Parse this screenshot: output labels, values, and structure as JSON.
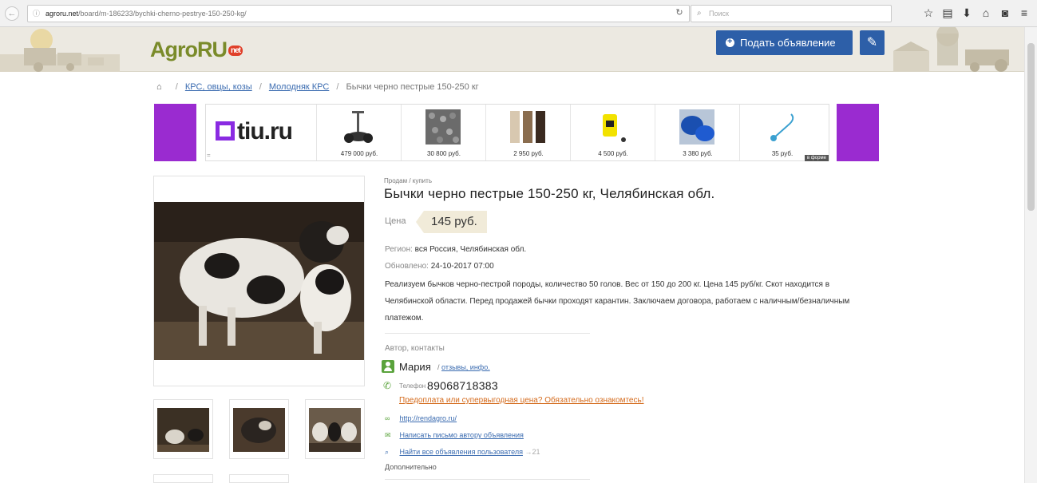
{
  "browser": {
    "url_domain": "agroru.net",
    "url_path": "/board/m-186233/bychki-cherno-pestrye-150-250-kg/",
    "search_placeholder": "Поиск"
  },
  "header": {
    "logo_main": "AgroRU",
    "logo_badge": "net",
    "post_button_label": "Подать объявление"
  },
  "breadcrumb": {
    "items": [
      {
        "label": "КРС, овцы, козы"
      },
      {
        "label": "Молодняк КРС"
      }
    ],
    "current": "Бычки черно пестрые 150-250 кг"
  },
  "ads": {
    "brand": "tiu.ru",
    "items": [
      {
        "price": "479 000 руб.",
        "icon": "segway-icon"
      },
      {
        "price": "30 800 руб.",
        "icon": "pellets-icon"
      },
      {
        "price": "2 950 руб.",
        "icon": "doors-icon"
      },
      {
        "price": "4 500 руб.",
        "icon": "pump-icon"
      },
      {
        "price": "3 380 руб.",
        "icon": "blue-hose-icon"
      },
      {
        "price": "35 руб.",
        "icon": "seal-icon"
      }
    ],
    "badge": "в форме",
    "eq": "="
  },
  "listing": {
    "kicker": "Продам / купить",
    "title": "Бычки черно пестрые 150-250 кг, Челябинская обл.",
    "price_label": "Цена",
    "price": "145 руб.",
    "region_label": "Регион:",
    "region": "вся Россия, Челябинская обл.",
    "updated_label": "Обновлено:",
    "updated": "24-10-2017 07:00",
    "description": "Реализуем бычков черно-пестрой породы, количество 50 голов. Вес от 150 до 200 кг. Цена 145 руб/кг. Скот находится в Челябинской области. Перед продажей бычки проходят карантин. Заключаем договора, работаем с наличным/безналичным платежом."
  },
  "author": {
    "heading": "Автор, контакты",
    "name": "Мария",
    "links_sep": "/",
    "links": "отзывы, инфо.",
    "phone_label": "Телефон",
    "phone": "89068718383",
    "warning": "Предоплата или супервыгодная цена? Обязательно ознакомтесь!",
    "website": "http://rendagro.ru/",
    "write_link": "Написать письмо автору объявления",
    "find_link": "Найти все объявления пользователя",
    "find_count": "→21",
    "extra": "Дополнительно"
  },
  "colors": {
    "brand_blue": "#2d5fa8",
    "ad_purple": "#9a2bd0",
    "accent_green": "#5aa33c",
    "warning_orange": "#d46a1b"
  }
}
